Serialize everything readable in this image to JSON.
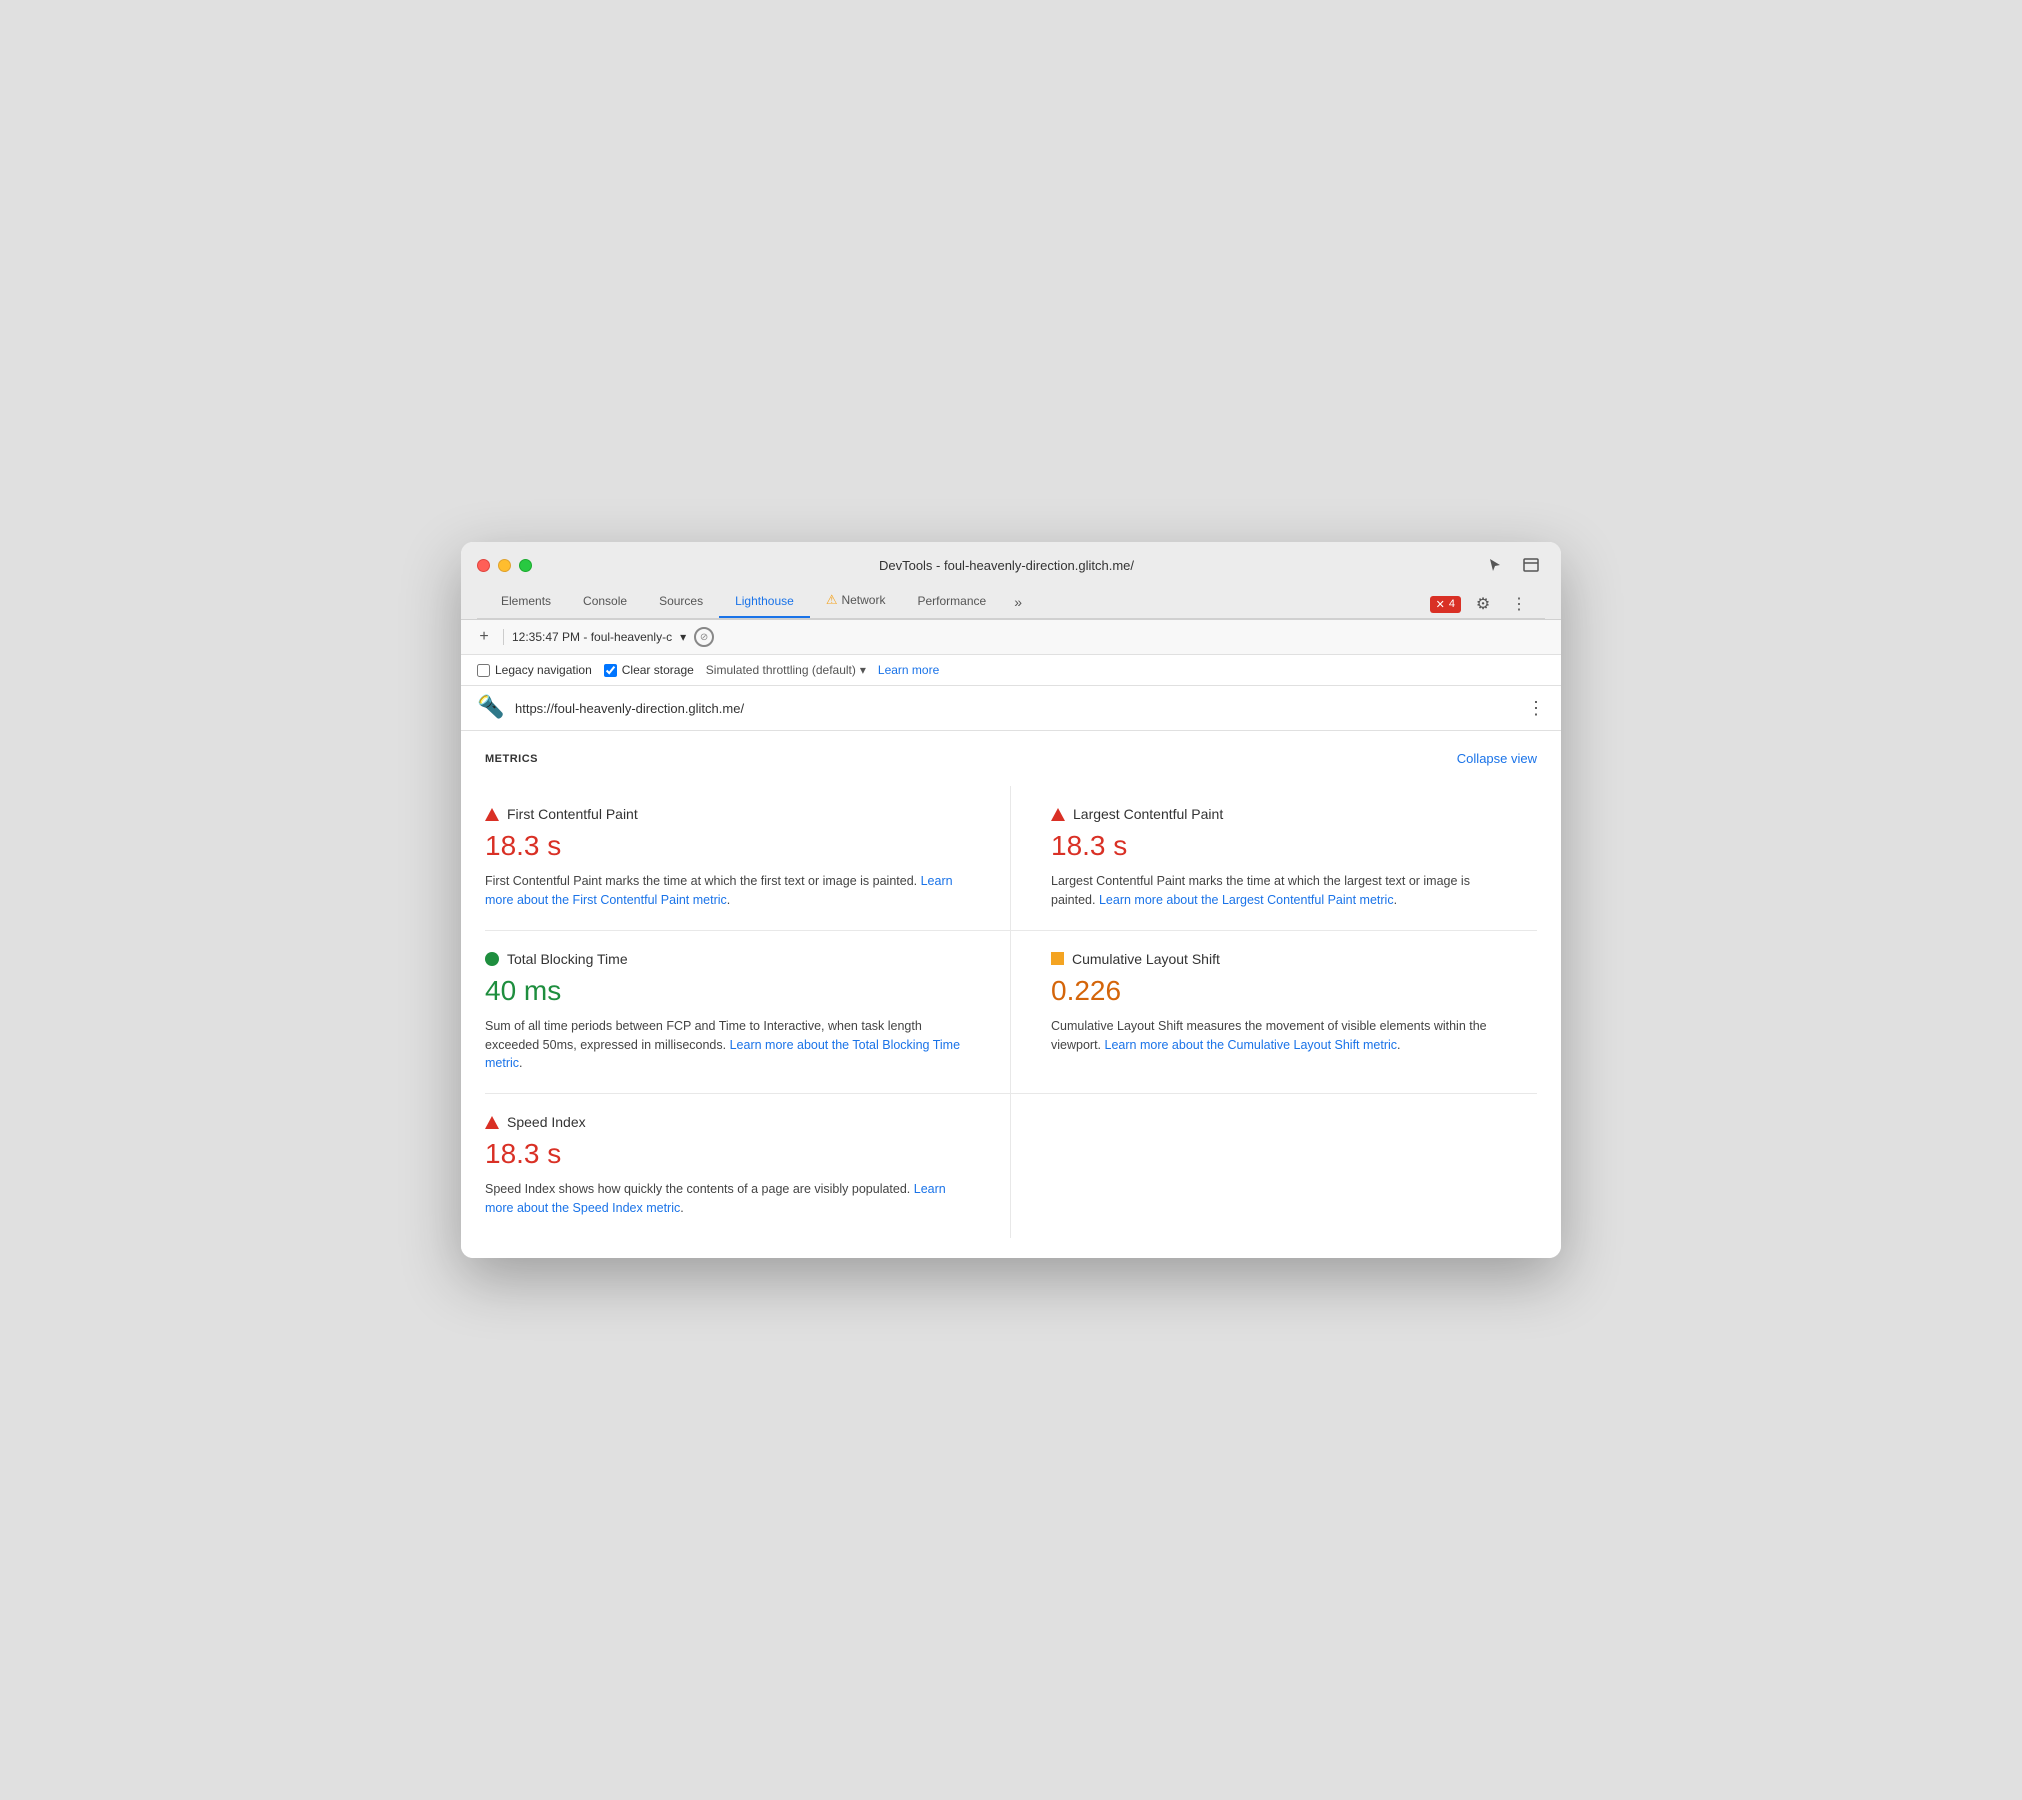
{
  "window": {
    "title": "DevTools - foul-heavenly-direction.glitch.me/"
  },
  "nav": {
    "tabs": [
      {
        "id": "elements",
        "label": "Elements",
        "active": false,
        "warning": false
      },
      {
        "id": "console",
        "label": "Console",
        "active": false,
        "warning": false
      },
      {
        "id": "sources",
        "label": "Sources",
        "active": false,
        "warning": false
      },
      {
        "id": "lighthouse",
        "label": "Lighthouse",
        "active": true,
        "warning": false
      },
      {
        "id": "network",
        "label": "Network",
        "active": false,
        "warning": true
      },
      {
        "id": "performance",
        "label": "Performance",
        "active": false,
        "warning": false
      }
    ],
    "more_label": "»",
    "error_count": "4",
    "gear_icon": "⚙",
    "more_icon": "⋮"
  },
  "toolbar": {
    "add_icon": "+",
    "time": "12:35:47 PM - foul-heavenly-c",
    "dropdown_icon": "▾",
    "block_icon": "⊘"
  },
  "options": {
    "legacy_nav_label": "Legacy navigation",
    "legacy_nav_checked": false,
    "clear_storage_label": "Clear storage",
    "clear_storage_checked": true,
    "throttle_label": "Simulated throttling (default)",
    "throttle_dropdown": "▾",
    "learn_more_label": "Learn more"
  },
  "url_bar": {
    "url": "https://foul-heavenly-direction.glitch.me/",
    "more_icon": "⋮"
  },
  "metrics_section": {
    "title": "METRICS",
    "collapse_label": "Collapse view",
    "metrics": [
      {
        "id": "fcp",
        "name": "First Contentful Paint",
        "indicator_type": "red-triangle",
        "value": "18.3 s",
        "value_color": "red",
        "description": "First Contentful Paint marks the time at which the first text or image is painted.",
        "link_text": "Learn more about the First Contentful Paint metric",
        "link_url": "#"
      },
      {
        "id": "lcp",
        "name": "Largest Contentful Paint",
        "indicator_type": "red-triangle",
        "value": "18.3 s",
        "value_color": "red",
        "description": "Largest Contentful Paint marks the time at which the largest text or image is painted.",
        "link_text": "Learn more about the Largest Contentful Paint metric",
        "link_url": "#"
      },
      {
        "id": "tbt",
        "name": "Total Blocking Time",
        "indicator_type": "green-circle",
        "value": "40 ms",
        "value_color": "green",
        "description": "Sum of all time periods between FCP and Time to Interactive, when task length exceeded 50ms, expressed in milliseconds.",
        "link_text": "Learn more about the Total Blocking Time metric",
        "link_url": "#"
      },
      {
        "id": "cls",
        "name": "Cumulative Layout Shift",
        "indicator_type": "orange-square",
        "value": "0.226",
        "value_color": "orange",
        "description": "Cumulative Layout Shift measures the movement of visible elements within the viewport.",
        "link_text": "Learn more about the Cumulative Layout Shift metric",
        "link_url": "#"
      },
      {
        "id": "si",
        "name": "Speed Index",
        "indicator_type": "red-triangle",
        "value": "18.3 s",
        "value_color": "red",
        "description": "Speed Index shows how quickly the contents of a page are visibly populated.",
        "link_text": "Learn more about the Speed Index metric",
        "link_url": "#"
      }
    ]
  }
}
